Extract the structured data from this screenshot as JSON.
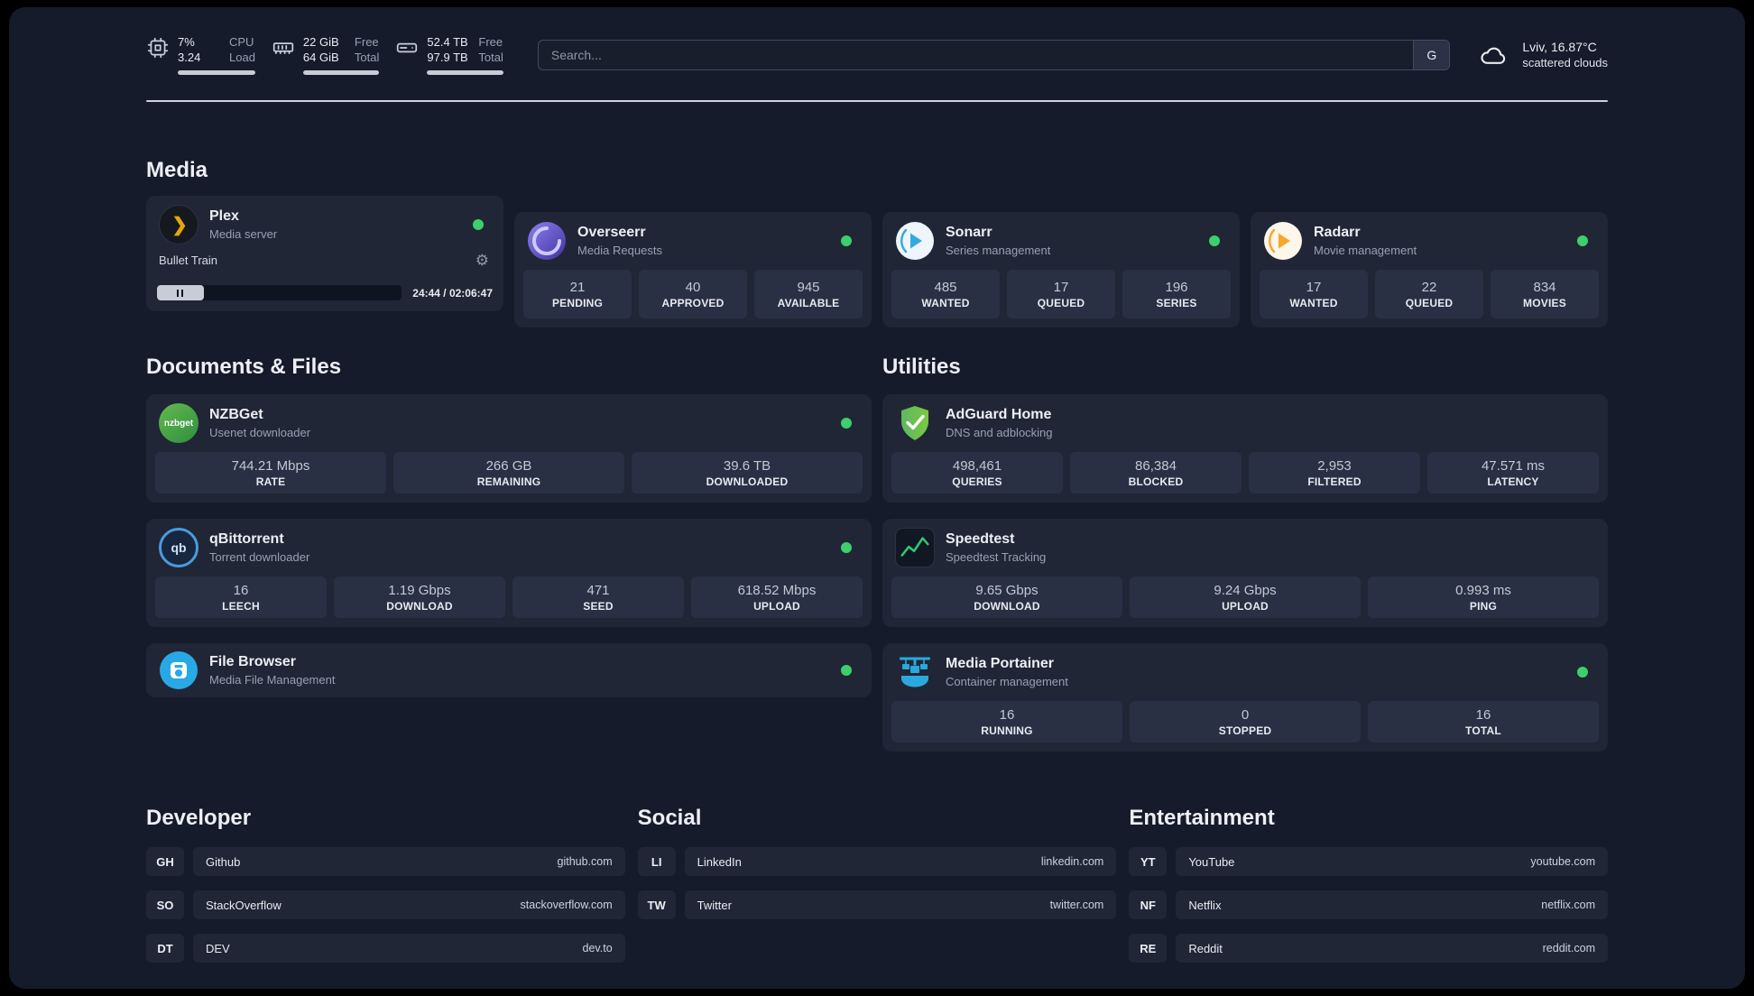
{
  "colors": {
    "background": "#161b2b",
    "card": "#202636",
    "stat_box": "#293043",
    "status_online": "#3ecf6a",
    "divider": "#ced2db",
    "plex_gold": "#e6a40e",
    "sonarr_blue": "#35a8e0",
    "radarr_amber": "#f7a72b",
    "nzbget_green": "#4caf50",
    "adguard_green": "#68bc71",
    "portainer_blue": "#2aa9de",
    "speedtest_green": "#2ecc71"
  },
  "topbar": {
    "cpu": {
      "values": [
        "7%",
        "3.24"
      ],
      "labels": [
        "CPU",
        "Load"
      ]
    },
    "memory": {
      "values": [
        "22 GiB",
        "64 GiB"
      ],
      "labels": [
        "Free",
        "Total"
      ]
    },
    "storage": {
      "values": [
        "52.4 TB",
        "97.9 TB"
      ],
      "labels": [
        "Free",
        "Total"
      ]
    },
    "search": {
      "placeholder": "Search...",
      "engine_button": "G"
    },
    "weather": {
      "location": "Lviv, 16.87°C",
      "condition": "scattered clouds"
    }
  },
  "sections": {
    "media": {
      "title": "Media",
      "apps": {
        "plex": {
          "name": "Plex",
          "subtitle": "Media server",
          "status": "online",
          "now_playing": "Bullet Train",
          "progress_time": "24:44 / 02:06:47",
          "progress_percent": 19
        },
        "overseerr": {
          "name": "Overseerr",
          "subtitle": "Media Requests",
          "status": "online",
          "stats": [
            {
              "value": "21",
              "label": "PENDING"
            },
            {
              "value": "40",
              "label": "APPROVED"
            },
            {
              "value": "945",
              "label": "AVAILABLE"
            }
          ]
        },
        "sonarr": {
          "name": "Sonarr",
          "subtitle": "Series management",
          "status": "online",
          "stats": [
            {
              "value": "485",
              "label": "WANTED"
            },
            {
              "value": "17",
              "label": "QUEUED"
            },
            {
              "value": "196",
              "label": "SERIES"
            }
          ]
        },
        "radarr": {
          "name": "Radarr",
          "subtitle": "Movie management",
          "status": "online",
          "stats": [
            {
              "value": "17",
              "label": "WANTED"
            },
            {
              "value": "22",
              "label": "QUEUED"
            },
            {
              "value": "834",
              "label": "MOVIES"
            }
          ]
        }
      }
    },
    "documents": {
      "title": "Documents & Files",
      "apps": {
        "nzbget": {
          "name": "NZBGet",
          "subtitle": "Usenet downloader",
          "status": "online",
          "icon_text": "nzbget",
          "stats": [
            {
              "value": "744.21 Mbps",
              "label": "RATE"
            },
            {
              "value": "266 GB",
              "label": "REMAINING"
            },
            {
              "value": "39.6 TB",
              "label": "DOWNLOADED"
            }
          ]
        },
        "qbittorrent": {
          "name": "qBittorrent",
          "subtitle": "Torrent downloader",
          "status": "online",
          "icon_text": "qb",
          "stats": [
            {
              "value": "16",
              "label": "LEECH"
            },
            {
              "value": "1.19 Gbps",
              "label": "DOWNLOAD"
            },
            {
              "value": "471",
              "label": "SEED"
            },
            {
              "value": "618.52 Mbps",
              "label": "UPLOAD"
            }
          ]
        },
        "filebrowser": {
          "name": "File Browser",
          "subtitle": "Media File Management",
          "status": "online"
        }
      }
    },
    "utilities": {
      "title": "Utilities",
      "apps": {
        "adguard": {
          "name": "AdGuard Home",
          "subtitle": "DNS and adblocking",
          "stats": [
            {
              "value": "498,461",
              "label": "QUERIES"
            },
            {
              "value": "86,384",
              "label": "BLOCKED"
            },
            {
              "value": "2,953",
              "label": "FILTERED"
            },
            {
              "value": "47.571 ms",
              "label": "LATENCY"
            }
          ]
        },
        "speedtest": {
          "name": "Speedtest",
          "subtitle": "Speedtest Tracking",
          "stats": [
            {
              "value": "9.65 Gbps",
              "label": "DOWNLOAD"
            },
            {
              "value": "9.24 Gbps",
              "label": "UPLOAD"
            },
            {
              "value": "0.993 ms",
              "label": "PING"
            }
          ]
        },
        "portainer": {
          "name": "Media Portainer",
          "subtitle": "Container management",
          "status": "online",
          "stats": [
            {
              "value": "16",
              "label": "RUNNING"
            },
            {
              "value": "0",
              "label": "STOPPED"
            },
            {
              "value": "16",
              "label": "TOTAL"
            }
          ]
        }
      }
    }
  },
  "bookmarks": {
    "developer": {
      "title": "Developer",
      "items": [
        {
          "abbr": "GH",
          "name": "Github",
          "url": "github.com"
        },
        {
          "abbr": "SO",
          "name": "StackOverflow",
          "url": "stackoverflow.com"
        },
        {
          "abbr": "DT",
          "name": "DEV",
          "url": "dev.to"
        }
      ]
    },
    "social": {
      "title": "Social",
      "items": [
        {
          "abbr": "LI",
          "name": "LinkedIn",
          "url": "linkedin.com"
        },
        {
          "abbr": "TW",
          "name": "Twitter",
          "url": "twitter.com"
        }
      ]
    },
    "entertainment": {
      "title": "Entertainment",
      "items": [
        {
          "abbr": "YT",
          "name": "YouTube",
          "url": "youtube.com"
        },
        {
          "abbr": "NF",
          "name": "Netflix",
          "url": "netflix.com"
        },
        {
          "abbr": "RE",
          "name": "Reddit",
          "url": "reddit.com"
        }
      ]
    }
  }
}
